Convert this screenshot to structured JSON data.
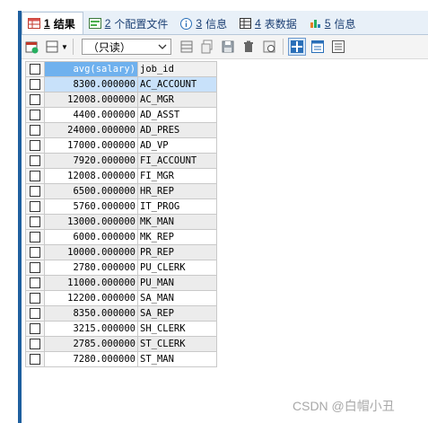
{
  "tabs": [
    {
      "num": "1",
      "label": "结果",
      "active": true,
      "icon": "result-grid-icon"
    },
    {
      "num": "2",
      "label": "个配置文件",
      "active": false,
      "icon": "profile-icon"
    },
    {
      "num": "3",
      "label": "信息",
      "active": false,
      "icon": "info-icon"
    },
    {
      "num": "4",
      "label": "表数据",
      "active": false,
      "icon": "table-data-icon"
    },
    {
      "num": "5",
      "label": "信息",
      "active": false,
      "icon": "history-info-icon"
    }
  ],
  "toolbar": {
    "mode_select": "（只读）"
  },
  "grid": {
    "columns": [
      "avg(salary)",
      "job_id"
    ],
    "rows": [
      [
        "8300.000000",
        "AC_ACCOUNT"
      ],
      [
        "12008.000000",
        "AC_MGR"
      ],
      [
        "4400.000000",
        "AD_ASST"
      ],
      [
        "24000.000000",
        "AD_PRES"
      ],
      [
        "17000.000000",
        "AD_VP"
      ],
      [
        "7920.000000",
        "FI_ACCOUNT"
      ],
      [
        "12008.000000",
        "FI_MGR"
      ],
      [
        "6500.000000",
        "HR_REP"
      ],
      [
        "5760.000000",
        "IT_PROG"
      ],
      [
        "13000.000000",
        "MK_MAN"
      ],
      [
        "6000.000000",
        "MK_REP"
      ],
      [
        "10000.000000",
        "PR_REP"
      ],
      [
        "2780.000000",
        "PU_CLERK"
      ],
      [
        "11000.000000",
        "PU_MAN"
      ],
      [
        "12200.000000",
        "SA_MAN"
      ],
      [
        "8350.000000",
        "SA_REP"
      ],
      [
        "3215.000000",
        "SH_CLERK"
      ],
      [
        "2785.000000",
        "ST_CLERK"
      ],
      [
        "7280.000000",
        "ST_MAN"
      ]
    ]
  },
  "watermark": "CSDN @白帽小丑",
  "colors": {
    "accent": "#1e5f9f",
    "header_selected": "#6fb1ee",
    "cell_selected": "#c8e1fa"
  }
}
